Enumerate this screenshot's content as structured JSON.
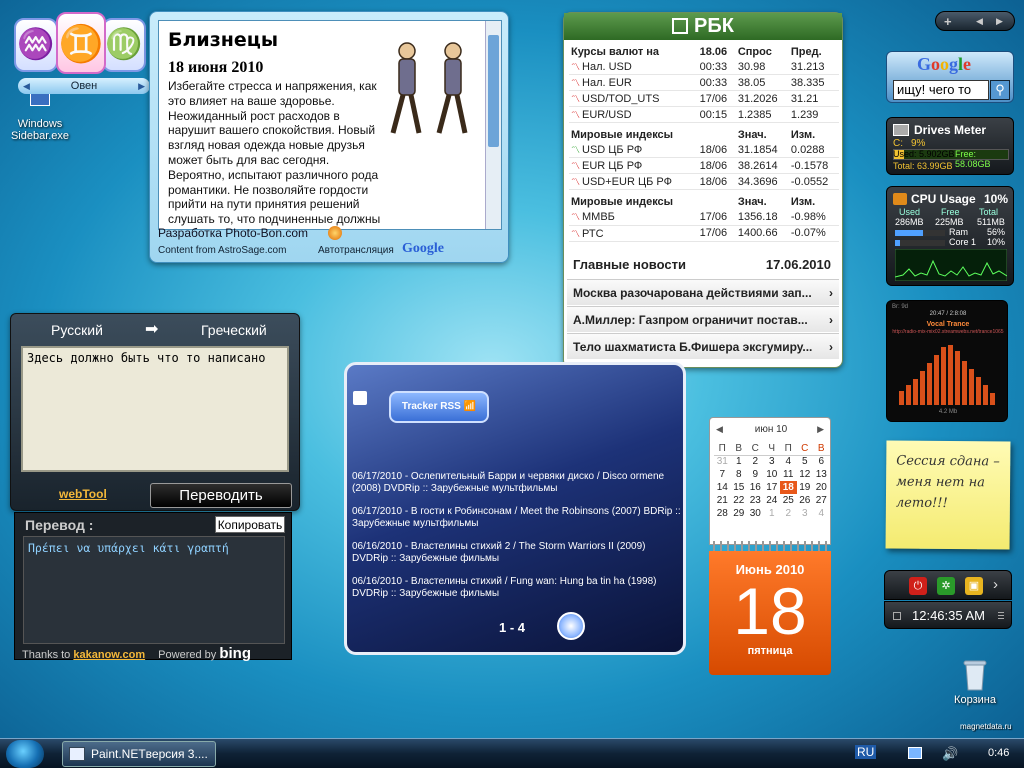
{
  "desktop": {
    "icon1_label": "Windows Sidebar.exe",
    "recycle_label": "Корзина",
    "watermark": "magnetdata.ru"
  },
  "zodiac": {
    "sign_label": "Овен",
    "left_arrow": "◀",
    "right_arrow": "▶"
  },
  "horoscope": {
    "title": "Близнецы",
    "date": "18 июня 2010",
    "text": "Избегайте стресса и напряжения, как это влияет на ваше здоровье. Неожиданный рост расходов в нарушит вашего спокойствия. Новый взгляд новая одежда новые друзья может быть для вас сегодня. Вероятно, испытают различного рода романтики. Не позволяйте гордости прийти на пути принятия решений слушать то, что подчиненные должны сказать. Сегодня это один из тех дней, когда вещи",
    "developer": "Разработка Photo-Bon.com",
    "content_from": "Content from AstroSage.com",
    "autotranslate": "Автотрансляция",
    "google": "Google"
  },
  "translator": {
    "from_lang": "Русский",
    "arrow": "➡",
    "to_lang": "Греческий",
    "input_text": "Здесь должно быть что то написано",
    "webtool": "webTool",
    "translate_button": "Переводить",
    "result_label": "Перевод :",
    "copy_button": "Копировать",
    "output_text": "Πρέπει να υπάρχει κάτι γραπτή",
    "thanks": "Thanks to",
    "kakanow": "kakanow.com",
    "powered": "Powered by",
    "bing": "bing"
  },
  "rbk": {
    "logo": "РБК",
    "currency_header": [
      "Курсы валют на",
      "18.06",
      "Спрос",
      "Пред."
    ],
    "currency_rows": [
      [
        "Нал. USD",
        "00:33",
        "30.98",
        "31.213"
      ],
      [
        "Нал. EUR",
        "00:33",
        "38.05",
        "38.335"
      ],
      [
        "USD/TOD_UTS",
        "17/06",
        "31.2026",
        "31.21"
      ],
      [
        "EUR/USD",
        "00:15",
        "1.2385",
        "1.239"
      ]
    ],
    "index1_header": [
      "Мировые индексы",
      "",
      "Знач.",
      "Изм."
    ],
    "index1_rows": [
      [
        "USD ЦБ РФ",
        "18/06",
        "31.1854",
        "0.0288"
      ],
      [
        "EUR ЦБ РФ",
        "18/06",
        "38.2614",
        "-0.1578"
      ],
      [
        "USD+EUR ЦБ РФ",
        "18/06",
        "34.3696",
        "-0.0552"
      ]
    ],
    "index2_header": [
      "Мировые индексы",
      "",
      "Знач.",
      "Изм."
    ],
    "index2_rows": [
      [
        "ММВБ",
        "17/06",
        "1356.18",
        "-0.98%"
      ],
      [
        "РТС",
        "17/06",
        "1400.66",
        "-0.07%"
      ]
    ],
    "news_title": "Главные новости",
    "news_date": "17.06.2010",
    "news": [
      "Москва разочарована действиями зап...",
      "А.Миллер: Газпром ограничит постав...",
      "Тело шахматиста Б.Фишера эксгумиру..."
    ]
  },
  "sidebar_controls": {
    "plus": "+",
    "prev": "◀",
    "next": "▶"
  },
  "google_gadget": {
    "logo": "Google",
    "search_value": "ищу! чего то"
  },
  "drives": {
    "title": "Drives Meter",
    "drive": "C:",
    "percent": "9%",
    "used": "Used: 5.902GB",
    "free": "Free: 58.08GB",
    "total": "Total: 63.99GB",
    "used_fraction": 0.09
  },
  "cpu": {
    "title": "CPU Usage",
    "percent": "10%",
    "used_label": "Used",
    "free_label": "Free",
    "total_label": "Total",
    "used": "286MB",
    "free": "225MB",
    "total": "511MB",
    "ram_label": "Ram",
    "ram": "56%",
    "core_label": "Core 1",
    "core": "10%",
    "ram_fraction": 0.56,
    "core_fraction": 0.1
  },
  "music": {
    "time": "20:47 / 2:8:08",
    "station": "Vocal Trance",
    "url": "http://radio-mix-mix02.streamwebs.net/trance1065",
    "bitrate": "4.2 Mb",
    "br": "Br: 9d"
  },
  "note": {
    "text": "Сессия сдана – меня нет на лето!!!"
  },
  "calendar": {
    "month_year": "июн 10",
    "days": [
      "П",
      "В",
      "С",
      "Ч",
      "П",
      "С",
      "В"
    ],
    "weeks": [
      [
        "31",
        "1",
        "2",
        "3",
        "4",
        "5",
        "6"
      ],
      [
        "7",
        "8",
        "9",
        "10",
        "11",
        "12",
        "13"
      ],
      [
        "14",
        "15",
        "16",
        "17",
        "18",
        "19",
        "20"
      ],
      [
        "21",
        "22",
        "23",
        "24",
        "25",
        "26",
        "27"
      ],
      [
        "28",
        "29",
        "30",
        "1",
        "2",
        "3",
        "4"
      ]
    ],
    "big_month": "Июнь 2010",
    "big_day": "18",
    "big_weekday": "пятница"
  },
  "rss": {
    "button": "Tracker RSS",
    "items": [
      "06/17/2010 - Ослепительный Барри и червяки диско / Disco ormene (2008) DVDRip :: Зарубежные мультфильмы",
      "06/17/2010 - В гости к Робинсонам / Meet the Robinsons (2007) BDRip :: Зарубежные мультфильмы",
      "06/16/2010 - Властелины стихий 2 / The Storm Warriors II (2009) DVDRip :: Зарубежные фильмы",
      "06/16/2010 - Властелины стихий / Fung wan: Hung ba tin ha (1998) DVDRip :: Зарубежные фильмы"
    ],
    "pager": "1 - 4"
  },
  "clock": {
    "time": "12:46:35 AM"
  },
  "taskbar": {
    "task_label": "Paint.NETверсия 3....",
    "lang": "RU",
    "time": "0:46"
  }
}
